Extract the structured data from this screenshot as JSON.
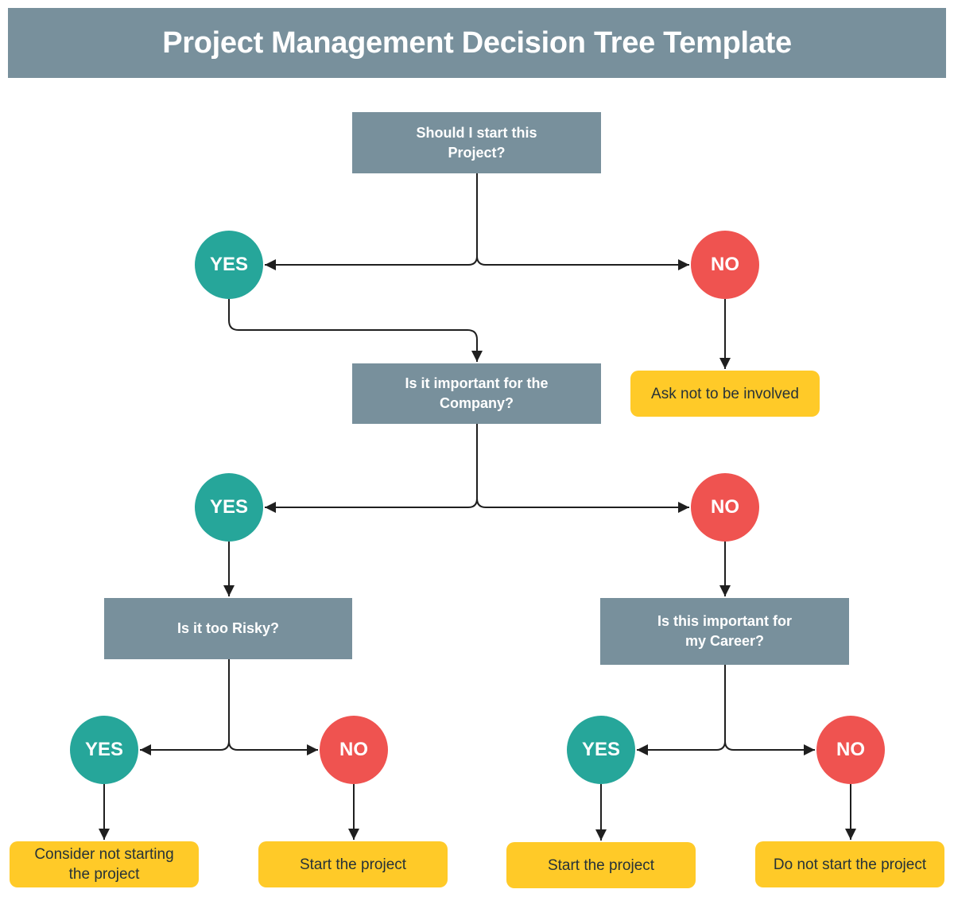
{
  "title": "Project Management Decision Tree Template",
  "colors": {
    "question": "#78909c",
    "yes": "#26a69a",
    "no": "#ef5350",
    "outcome": "#ffca28",
    "connector": "#1f1f1f"
  },
  "questions": {
    "q1": "Should I start this Project?",
    "q2": "Is it important for the Company?",
    "q3": "Is it too Risky?",
    "q4": "Is this important for my Career?"
  },
  "answers": {
    "yes": "YES",
    "no": "NO"
  },
  "outcomes": {
    "q1_no": "Ask not to be involved",
    "q3_yes": "Consider not starting the project",
    "q3_no": "Start the project",
    "q4_yes": "Start the project",
    "q4_no": "Do not start the project"
  },
  "tree": {
    "q1": {
      "yes": "q2",
      "no": "q1_no"
    },
    "q2": {
      "yes": "q3",
      "no": "q4"
    },
    "q3": {
      "yes": "q3_yes",
      "no": "q3_no"
    },
    "q4": {
      "yes": "q4_yes",
      "no": "q4_no"
    }
  }
}
